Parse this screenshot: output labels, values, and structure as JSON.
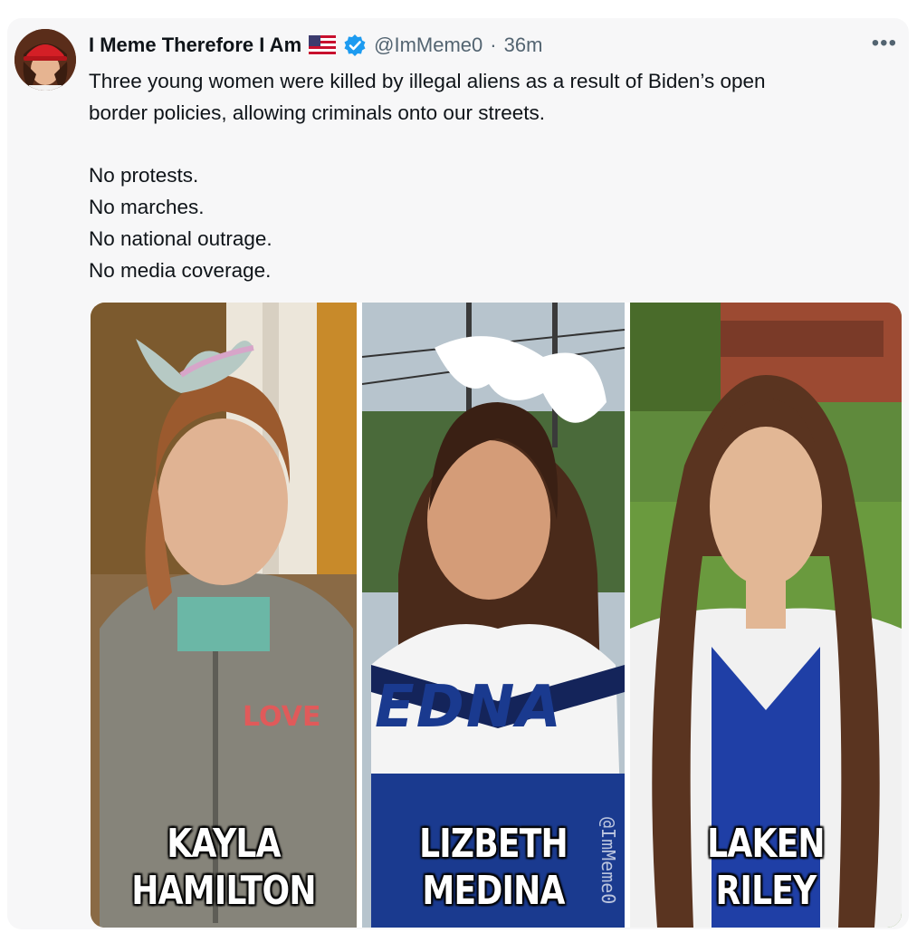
{
  "tweet": {
    "display_name": "I Meme Therefore I Am",
    "flag_icon": "us-flag-icon",
    "verified_icon": "verified-badge-icon",
    "handle": "@ImMeme0",
    "separator": "·",
    "time": "36m",
    "more_icon": "more-options-icon",
    "text_lines": [
      "Three young women were killed by illegal aliens as a result of Biden’s open",
      "border policies, allowing criminals onto our streets.",
      "No protests.",
      "No marches.",
      "No national outrage.",
      "No media coverage."
    ]
  },
  "media": {
    "panels": [
      {
        "caption_line1": "KAYLA",
        "caption_line2": "HAMILTON",
        "shirt_text": "LOVE"
      },
      {
        "caption_line1": "LIZBETH",
        "caption_line2": "MEDINA",
        "shirt_text": "EDNA",
        "watermark": "@ImMeme0"
      },
      {
        "caption_line1": "LAKEN",
        "caption_line2": "RILEY"
      }
    ]
  },
  "colors": {
    "card_background": "#f7f7f8",
    "verified_blue": "#1d9bf0",
    "text_primary": "#0f1419",
    "text_secondary": "#536471"
  }
}
